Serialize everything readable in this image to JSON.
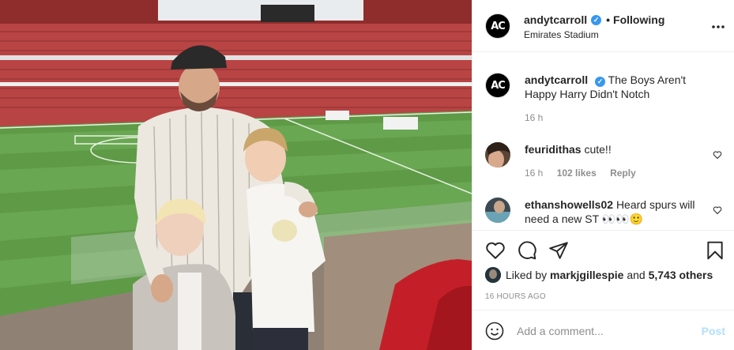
{
  "post": {
    "username": "andytcarroll",
    "avatar_initials": "AC",
    "follow_separator": "•",
    "follow_status": "Following",
    "location": "Emirates Stadium",
    "caption": "The Boys Aren't Happy Harry Didn't Notch",
    "caption_time": "16 h",
    "verified": true
  },
  "comments": [
    {
      "username": "feuridithas",
      "text": "cute!!",
      "time": "16 h",
      "likes": "102 likes",
      "reply": "Reply"
    },
    {
      "username": "ethanshowells02",
      "text": "Heard spurs will need a new ST 👀👀🙂",
      "time": "",
      "likes": "",
      "reply": ""
    }
  ],
  "actions": {
    "liked_prefix": "Liked by",
    "liked_user": "markjgillespie",
    "liked_and": "and",
    "liked_count": "5,743 others",
    "timestamp": "16 HOURS AGO"
  },
  "composer": {
    "placeholder": "Add a comment...",
    "post_label": "Post"
  },
  "icons": {
    "verified": "verified-badge-icon",
    "more": "more-options-icon",
    "like": "heart-icon",
    "comment": "comment-icon",
    "share": "share-icon",
    "save": "bookmark-icon",
    "emoji": "emoji-icon"
  }
}
